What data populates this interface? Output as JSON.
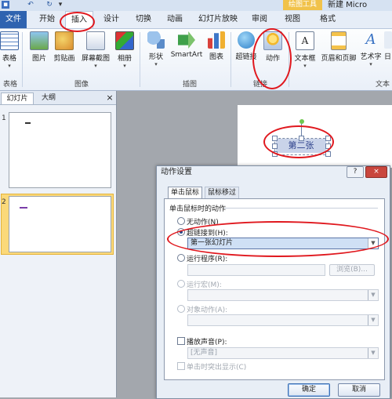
{
  "window": {
    "context_tab": "绘图工具",
    "doc_title": "新建 Micro"
  },
  "tabs": [
    {
      "label": "文件"
    },
    {
      "label": "开始"
    },
    {
      "label": "插入"
    },
    {
      "label": "设计"
    },
    {
      "label": "切换"
    },
    {
      "label": "动画"
    },
    {
      "label": "幻灯片放映"
    },
    {
      "label": "审阅"
    },
    {
      "label": "视图"
    },
    {
      "label": "格式"
    }
  ],
  "ribbon": {
    "buttons": [
      {
        "label": "表格",
        "icon": "table-icon"
      },
      {
        "label": "图片",
        "icon": "picture-icon"
      },
      {
        "label": "剪贴画",
        "icon": "clipart-icon"
      },
      {
        "label": "屏幕截图",
        "icon": "screenshot-icon"
      },
      {
        "label": "相册",
        "icon": "album-icon"
      },
      {
        "label": "形状",
        "icon": "shapes-icon"
      },
      {
        "label": "SmartArt",
        "icon": "smartart-icon"
      },
      {
        "label": "图表",
        "icon": "chart-icon"
      },
      {
        "label": "超链接",
        "icon": "hyperlink-icon"
      },
      {
        "label": "动作",
        "icon": "action-icon"
      },
      {
        "label": "文本框",
        "icon": "textbox-icon"
      },
      {
        "label": "页眉和页脚",
        "icon": "header-footer-icon"
      },
      {
        "label": "艺术字",
        "icon": "wordart-icon"
      },
      {
        "label": "日"
      }
    ],
    "groups": [
      {
        "label": "表格"
      },
      {
        "label": "图像"
      },
      {
        "label": "插图"
      },
      {
        "label": "链接"
      },
      {
        "label": "文本"
      }
    ]
  },
  "pane": {
    "tabs": [
      {
        "label": "幻灯片"
      },
      {
        "label": "大纲"
      }
    ],
    "close": "×",
    "slides": [
      {
        "num": "1"
      },
      {
        "num": "2"
      }
    ]
  },
  "slide": {
    "selected_text": "第二张"
  },
  "dialog": {
    "title": "动作设置",
    "help": "?",
    "close": "×",
    "tabs": [
      {
        "label": "单击鼠标"
      },
      {
        "label": "鼠标移过"
      }
    ],
    "section_title": "单击鼠标时的动作",
    "options": {
      "none": "无动作(N)",
      "hyperlink": "超链接到(H):",
      "hyperlink_value": "第一张幻灯片",
      "run_program": "运行程序(R):",
      "browse": "浏览(B)...",
      "run_macro": "运行宏(M):",
      "object_action": "对象动作(A):"
    },
    "sound_label": "播放声音(P):",
    "sound_value": "[无声音]",
    "highlight_label": "单击时突出显示(C)",
    "ok": "确定",
    "cancel": "取消"
  }
}
